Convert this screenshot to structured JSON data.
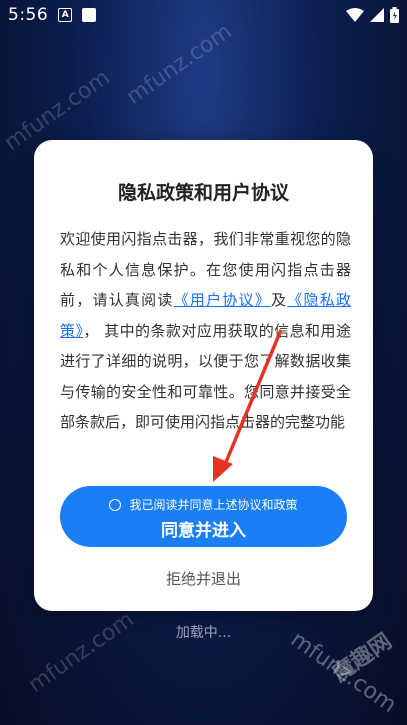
{
  "status": {
    "time": "5:56",
    "notif_a": "A"
  },
  "watermarks": [
    "mfunz.com",
    "mfunz.com",
    "mfunz.com",
    "魔趣网",
    "mfunz.com"
  ],
  "dialog": {
    "title": "隐私政策和用户协议",
    "body_1": "欢迎使用闪指点击器，我们非常重视您的隐私和个人信息保护。在您使用闪指点击器前，请认真阅读",
    "link_user": "《用户协议》",
    "and_text": "及",
    "link_privacy": "《隐私政策》",
    "body_2": "， 其中的条款对应用获取的信息和用途进行了详细的说明，以便于您了解数据收集与传输的安全性和可靠性。您同意并接受全部条款后，即可使用闪指点击器的完整功能",
    "agree_checkbox_text": "我已阅读并同意上述协议和政策",
    "agree_button": "同意并进入",
    "reject_button": "拒绝并退出"
  },
  "loading_text": "加载中..."
}
